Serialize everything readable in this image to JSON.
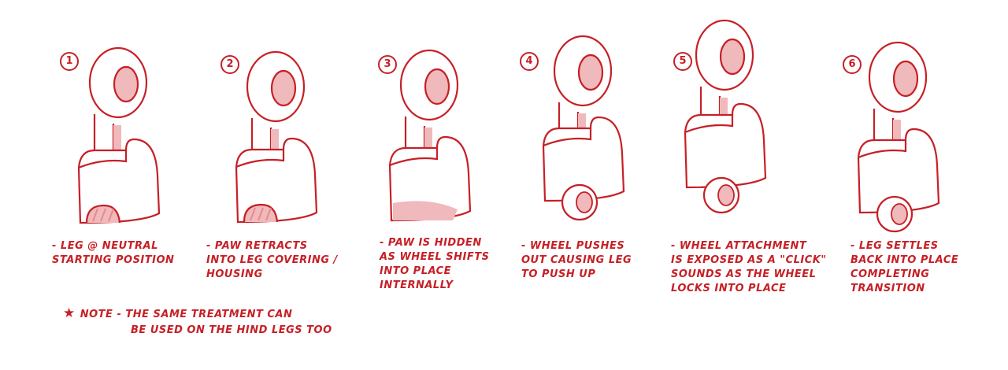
{
  "steps": [
    {
      "number": "1",
      "lines": [
        "- LEG @ NEUTRAL",
        "STARTING POSITION"
      ]
    },
    {
      "number": "2",
      "lines": [
        "- PAW RETRACTS",
        "INTO LEG COVERING /",
        "HOUSING"
      ]
    },
    {
      "number": "3",
      "lines": [
        "- PAW IS HIDDEN",
        "AS WHEEL SHIFTS",
        "INTO PLACE",
        "INTERNALLY"
      ]
    },
    {
      "number": "4",
      "lines": [
        "- WHEEL PUSHES",
        "OUT CAUSING LEG",
        "TO PUSH UP"
      ]
    },
    {
      "number": "5",
      "lines": [
        "- WHEEL ATTACHMENT",
        "IS EXPOSED AS A \"CLICK\"",
        "SOUNDS AS THE WHEEL",
        "LOCKS INTO PLACE"
      ]
    },
    {
      "number": "6",
      "lines": [
        "- LEG SETTLES",
        "BACK INTO PLACE",
        "COMPLETING",
        "TRANSITION"
      ]
    }
  ],
  "note": {
    "star": "★",
    "label": "NOTE",
    "line1": "- THE SAME TREATMENT CAN",
    "line2": "BE USED ON THE HIND LEGS TOO"
  },
  "colors": {
    "ink": "#c62026",
    "shade": "#f0b9bb",
    "light": "#e8888c"
  }
}
